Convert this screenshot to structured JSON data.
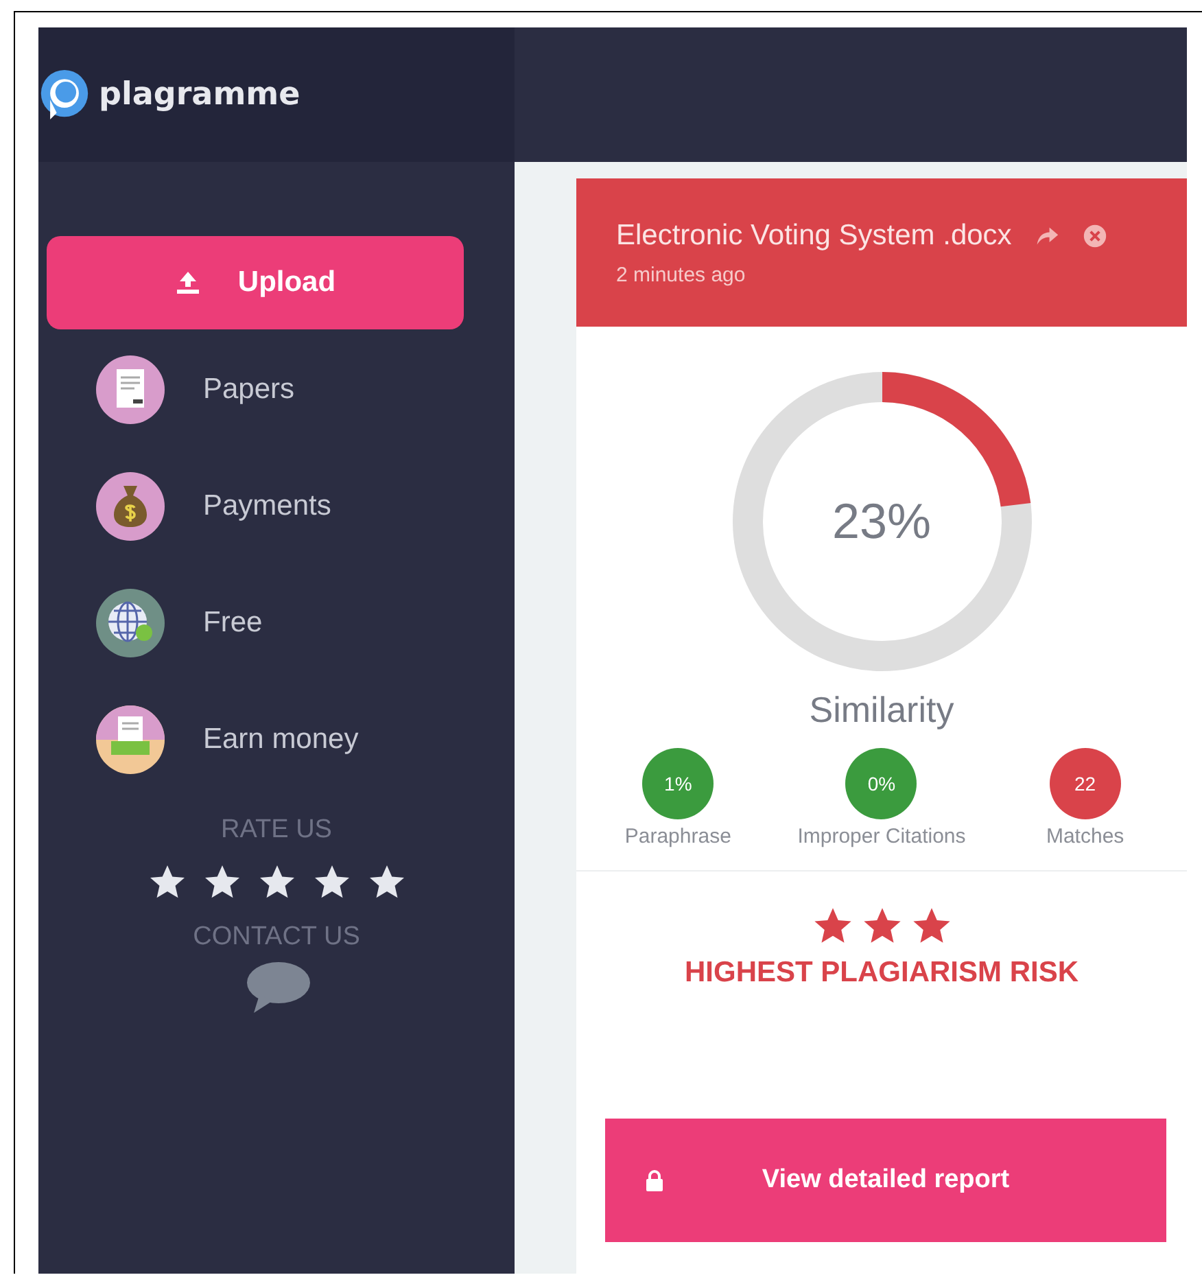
{
  "brand": {
    "name": "plagramme"
  },
  "sidebar": {
    "upload_button": "Upload",
    "items": [
      {
        "label": "Papers",
        "kind": "papers"
      },
      {
        "label": "Payments",
        "kind": "payments"
      },
      {
        "label": "Free",
        "kind": "free"
      },
      {
        "label": "Earn money",
        "kind": "earn"
      }
    ],
    "rate_us": {
      "label": "RATE US",
      "stars": 5
    },
    "contact_us": "CONTACT US"
  },
  "report": {
    "file_name": "Electronic Voting System .docx",
    "time": "2 minutes ago",
    "similarity": {
      "level": 0.23,
      "value": "23%",
      "label": "Similarity"
    },
    "stats": [
      {
        "value": "1%",
        "label": "Paraphrase",
        "color": "#3b9b3e"
      },
      {
        "value": "0%",
        "label": "Improper Citations",
        "color": "#3b9b3e"
      },
      {
        "value": "22",
        "label": "Matches",
        "color": "#d9434a"
      }
    ],
    "risk": {
      "stars": 3,
      "label": "HIGHEST PLAGIARISM RISK"
    },
    "view_button": "View detailed report"
  }
}
